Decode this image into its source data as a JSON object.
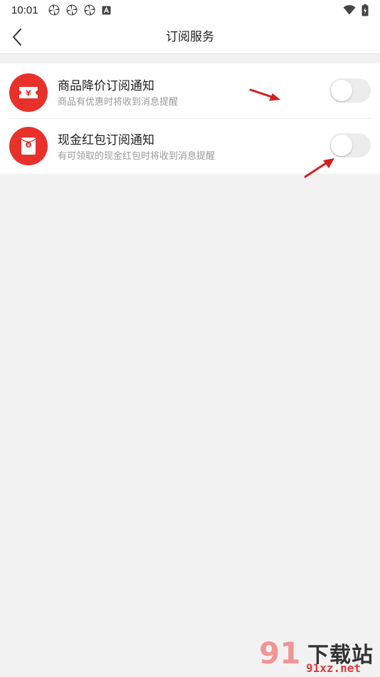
{
  "status_bar": {
    "time": "10:01",
    "left_icons": [
      "pinwheel-icon",
      "pinwheel-icon",
      "pinwheel-icon",
      "font-a-icon"
    ],
    "right_icons": [
      "wifi-icon",
      "battery-charging-icon"
    ]
  },
  "header": {
    "back_icon": "chevron-left-icon",
    "title": "订阅服务"
  },
  "settings": [
    {
      "icon": "coupon-yen-icon",
      "title": "商品降价订阅通知",
      "subtitle": "商品有优惠时将收到消息提醒",
      "enabled": false
    },
    {
      "icon": "red-envelope-icon",
      "title": "现金红包订阅通知",
      "subtitle": "有可领取的现金红包时将收到消息提醒",
      "enabled": false
    }
  ],
  "watermark": {
    "logo": "91",
    "name": "下载站",
    "domain": "91xz.net"
  },
  "colors": {
    "accent": "#e8312a",
    "background": "#f2f2f2",
    "toggle_off": "#ececec"
  }
}
